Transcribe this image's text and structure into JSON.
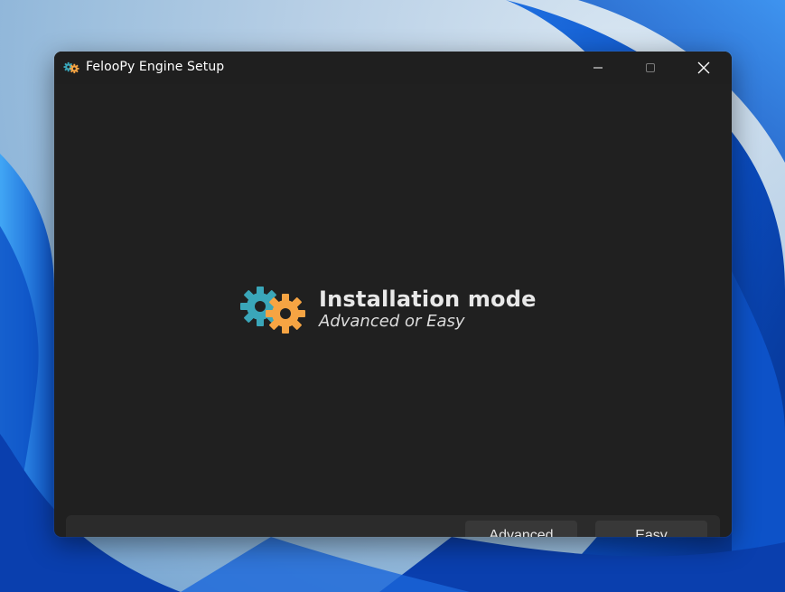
{
  "window": {
    "title": "FelooPy Engine Setup",
    "app_icon": "gears-icon"
  },
  "caption_buttons": {
    "minimize": "minimize-icon",
    "maximize": "maximize-icon",
    "close": "close-icon"
  },
  "hero": {
    "icon": "gears-icon",
    "title": "Installation mode",
    "subtitle": "Advanced or Easy"
  },
  "footer": {
    "advanced_label": "Advanced",
    "easy_label": "Easy"
  },
  "colors": {
    "window_bg": "#202020",
    "gear_teal": "#3aa6b9",
    "gear_orange": "#f6a443",
    "button_bg": "#383838"
  }
}
